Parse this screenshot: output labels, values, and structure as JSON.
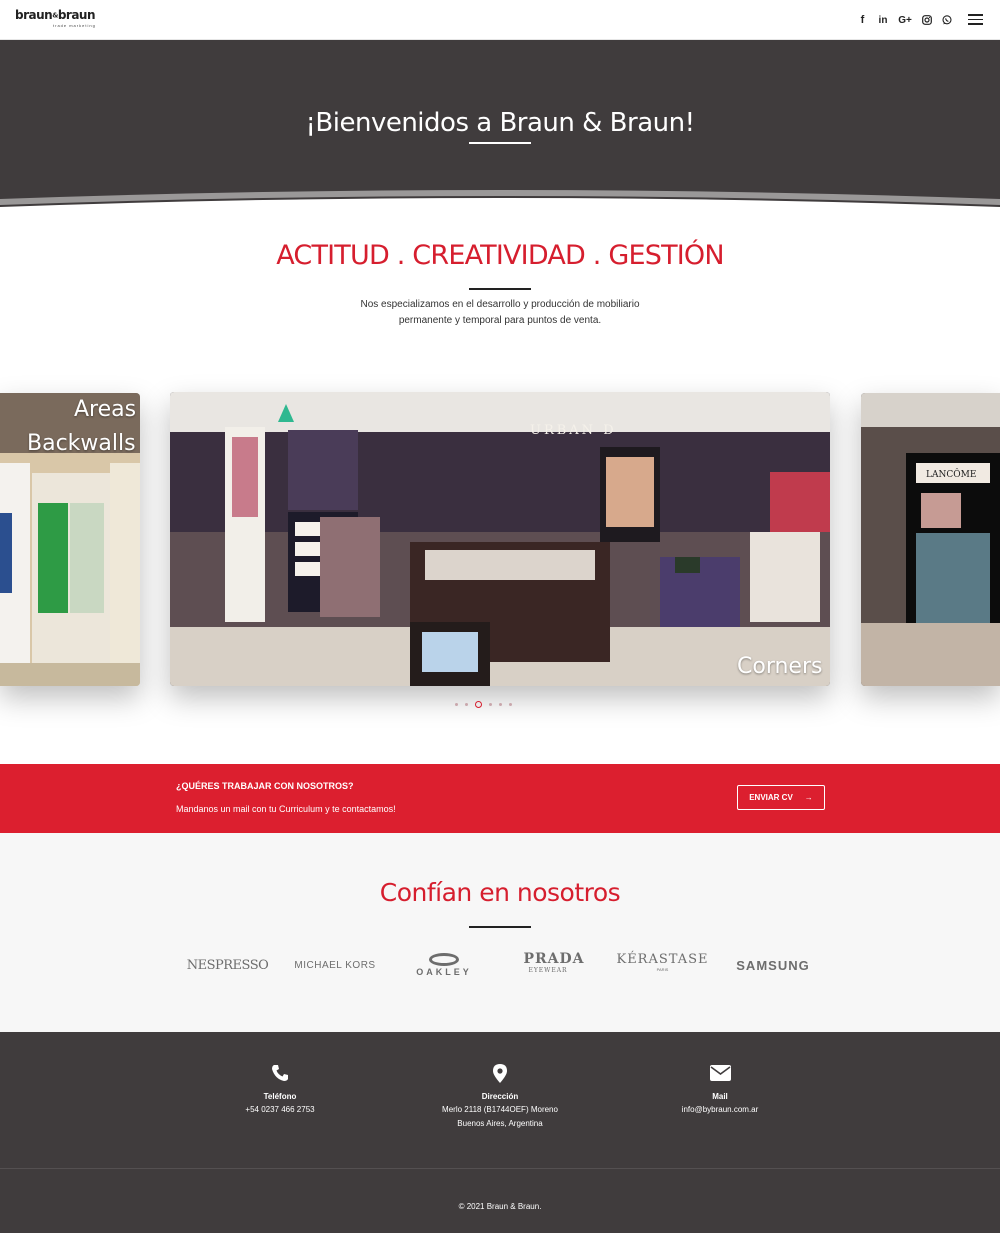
{
  "header": {
    "logo_text_left": "braun",
    "logo_amp": "&",
    "logo_text_right": "braun",
    "logo_subtitle": "trade marketing",
    "social": [
      "facebook-icon",
      "linkedin-icon",
      "google-plus-icon",
      "instagram-icon",
      "whatsapp-icon"
    ],
    "social_glyphs": {
      "facebook": "f",
      "linkedin": "in",
      "google": "G+"
    }
  },
  "hero": {
    "title": "¡Bienvenidos a Braun & Braun!"
  },
  "intro": {
    "tagline": "ACTITUD . CREATIVIDAD . GESTIÓN",
    "line1": "Nos especializamos en el desarrollo y producción de mobiliario",
    "line2": "permanente y temporal para puntos de venta."
  },
  "carousel": {
    "slides": [
      "Areas",
      "Backwalls",
      "Corners"
    ],
    "store_sign": "URBAN D",
    "store_sign_right": "LANCÔME",
    "dots_total": 6,
    "active_index": 2
  },
  "cta": {
    "question": "¿QUÉRES TRABAJAR CON NOSOTROS?",
    "message": "Mandanos un mail con tu Curriculum y te contactamos!",
    "button": "ENVIAR CV",
    "button_arrow": "→"
  },
  "brands": {
    "title": "Confían en nosotros",
    "items": {
      "nespresso": "NESPRESSO",
      "michael_kors": "MICHAEL KORS",
      "oakley": "OAKLEY",
      "prada": "PRADA",
      "prada_sub": "EYEWEAR",
      "kerastase": "KÉRASTASE",
      "kerastase_sub": "PARIS",
      "samsung": "SAMSUNG"
    }
  },
  "footer": {
    "phone_label": "Teléfono",
    "phone_value": "+54 0237 466 2753",
    "address_label": "Dirección",
    "address_line1": "Merlo 2118 (B1744OEF) Moreno",
    "address_line2": "Buenos Aires, Argentina",
    "mail_label": "Mail",
    "mail_value": "info@bybraun.com.ar",
    "copyright": "© 2021 Braun & Braun."
  },
  "colors": {
    "accent": "#dc1f2f",
    "dark": "#403c3d"
  }
}
